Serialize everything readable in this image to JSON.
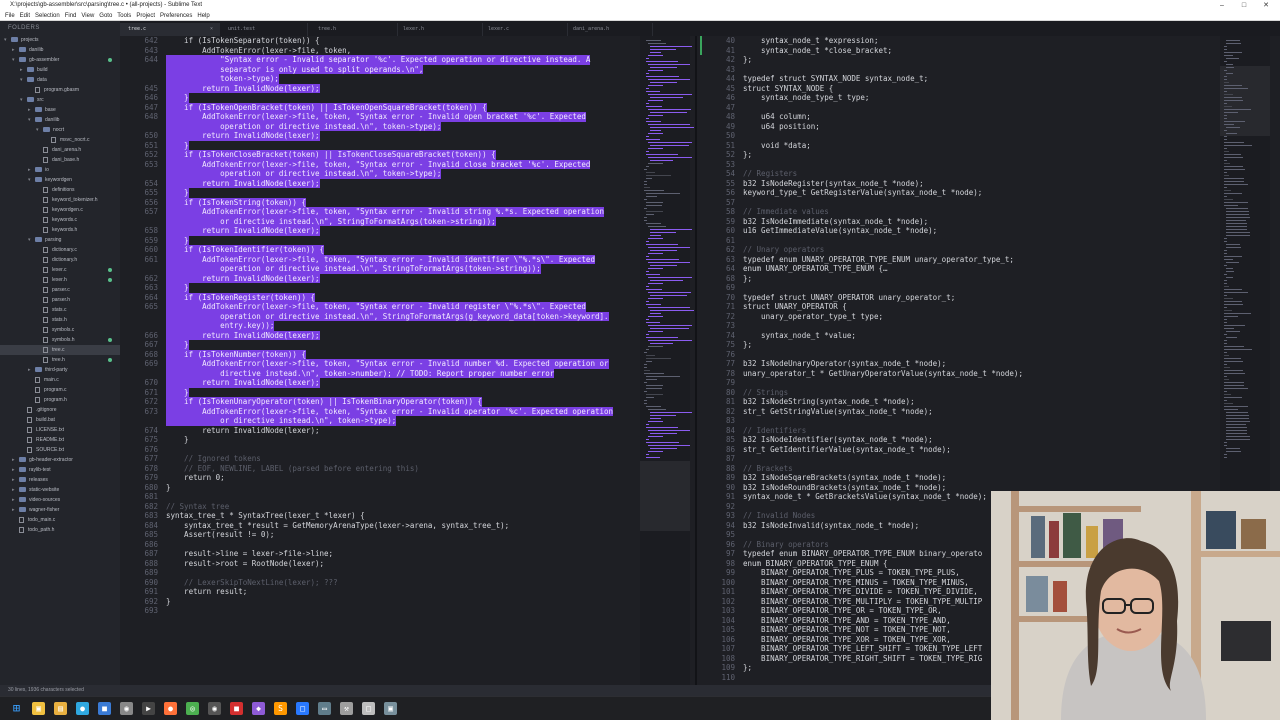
{
  "window": {
    "title": "X:\\projects\\gb-assembler\\src\\parsing\\tree.c • (all-projects) - Sublime Text"
  },
  "menu": [
    "File",
    "Edit",
    "Selection",
    "Find",
    "View",
    "Goto",
    "Tools",
    "Project",
    "Preferences",
    "Help"
  ],
  "sidebar": {
    "header": "FOLDERS",
    "items": [
      {
        "label": "projects",
        "depth": 0,
        "type": "folder",
        "open": true
      },
      {
        "label": "danilib",
        "depth": 1,
        "type": "folder",
        "open": false
      },
      {
        "label": "gb-assembler",
        "depth": 1,
        "type": "folder",
        "open": true,
        "dot": true
      },
      {
        "label": "build",
        "depth": 2,
        "type": "folder",
        "open": false
      },
      {
        "label": "data",
        "depth": 2,
        "type": "folder",
        "open": true
      },
      {
        "label": "program.gbasm",
        "depth": 3,
        "type": "file"
      },
      {
        "label": "src",
        "depth": 2,
        "type": "folder",
        "open": true
      },
      {
        "label": "base",
        "depth": 3,
        "type": "folder",
        "open": false
      },
      {
        "label": "danilib",
        "depth": 3,
        "type": "folder",
        "open": true
      },
      {
        "label": "nocrt",
        "depth": 4,
        "type": "folder",
        "open": true
      },
      {
        "label": "msvc_nocrt.c",
        "depth": 5,
        "type": "file"
      },
      {
        "label": "dani_arena.h",
        "depth": 4,
        "type": "file"
      },
      {
        "label": "dani_base.h",
        "depth": 4,
        "type": "file"
      },
      {
        "label": "io",
        "depth": 3,
        "type": "folder",
        "open": false
      },
      {
        "label": "keywordgen",
        "depth": 3,
        "type": "folder",
        "open": true
      },
      {
        "label": "definitions",
        "depth": 4,
        "type": "file"
      },
      {
        "label": "keyword_tokenizer.h",
        "depth": 4,
        "type": "file"
      },
      {
        "label": "keywordgen.c",
        "depth": 4,
        "type": "file"
      },
      {
        "label": "keywords.c",
        "depth": 4,
        "type": "file"
      },
      {
        "label": "keywords.h",
        "depth": 4,
        "type": "file"
      },
      {
        "label": "parsing",
        "depth": 3,
        "type": "folder",
        "open": true
      },
      {
        "label": "dictionary.c",
        "depth": 4,
        "type": "file"
      },
      {
        "label": "dictionary.h",
        "depth": 4,
        "type": "file"
      },
      {
        "label": "lexer.c",
        "depth": 4,
        "type": "file",
        "dot": true
      },
      {
        "label": "lexer.h",
        "depth": 4,
        "type": "file",
        "dot": true
      },
      {
        "label": "parser.c",
        "depth": 4,
        "type": "file"
      },
      {
        "label": "parser.h",
        "depth": 4,
        "type": "file"
      },
      {
        "label": "stats.c",
        "depth": 4,
        "type": "file"
      },
      {
        "label": "stats.h",
        "depth": 4,
        "type": "file"
      },
      {
        "label": "symbols.c",
        "depth": 4,
        "type": "file"
      },
      {
        "label": "symbols.h",
        "depth": 4,
        "type": "file",
        "dot": true
      },
      {
        "label": "tree.c",
        "depth": 4,
        "type": "file",
        "selected": true
      },
      {
        "label": "tree.h",
        "depth": 4,
        "type": "file",
        "dot": true
      },
      {
        "label": "third-party",
        "depth": 3,
        "type": "folder",
        "open": false
      },
      {
        "label": "main.c",
        "depth": 3,
        "type": "file"
      },
      {
        "label": "program.c",
        "depth": 3,
        "type": "file"
      },
      {
        "label": "program.h",
        "depth": 3,
        "type": "file"
      },
      {
        "label": ".gitignore",
        "depth": 2,
        "type": "file"
      },
      {
        "label": "build.bat",
        "depth": 2,
        "type": "file"
      },
      {
        "label": "LICENSE.txt",
        "depth": 2,
        "type": "file"
      },
      {
        "label": "README.txt",
        "depth": 2,
        "type": "file"
      },
      {
        "label": "SOURCE.txt",
        "depth": 2,
        "type": "file"
      },
      {
        "label": "gb-header-extractor",
        "depth": 1,
        "type": "folder",
        "open": false
      },
      {
        "label": "raylib-test",
        "depth": 1,
        "type": "folder",
        "open": false
      },
      {
        "label": "releases",
        "depth": 1,
        "type": "folder",
        "open": false
      },
      {
        "label": "static-website",
        "depth": 1,
        "type": "folder",
        "open": false
      },
      {
        "label": "video-sources",
        "depth": 1,
        "type": "folder",
        "open": false
      },
      {
        "label": "wagner-fisher",
        "depth": 1,
        "type": "folder",
        "open": false
      },
      {
        "label": "todo_main.c",
        "depth": 1,
        "type": "file"
      },
      {
        "label": "todo_path.h",
        "depth": 1,
        "type": "file"
      }
    ]
  },
  "tabs": [
    {
      "label": "tree.c",
      "active": true
    },
    {
      "label": "unit.test",
      "active": false
    },
    {
      "label": "tree.h",
      "active": false
    },
    {
      "label": "lexer.h",
      "active": false
    },
    {
      "label": "lexer.c",
      "active": false
    },
    {
      "label": "dani_arena.h",
      "active": false
    }
  ],
  "left_code": [
    {
      "n": "642",
      "t": "    if (IsTokenSeparator(token)) {"
    },
    {
      "n": "643",
      "t": "        AddTokenError(lexer->file, token,"
    },
    {
      "n": "644",
      "t": "            \"Syntax error - Invalid separator '%c'. Expected operation or directive instead. A",
      "hl": true
    },
    {
      "n": "",
      "t": "            separator is only used to split operands.\\n\",",
      "hl": true
    },
    {
      "n": "",
      "t": "            token->type);",
      "hl": true
    },
    {
      "n": "645",
      "t": "        return InvalidNode(lexer);",
      "hl": true
    },
    {
      "n": "646",
      "t": "    }",
      "hl": true
    },
    {
      "n": "647",
      "t": "    if (IsTokenOpenBracket(token) || IsTokenOpenSquareBracket(token)) {",
      "hl": true
    },
    {
      "n": "648",
      "t": "        AddTokenError(lexer->file, token, \"Syntax error - Invalid open bracket '%c'. Expected",
      "hl": true
    },
    {
      "n": "",
      "t": "            operation or directive instead.\\n\", token->type);",
      "hl": true
    },
    {
      "n": "650",
      "t": "        return InvalidNode(lexer);",
      "hl": true
    },
    {
      "n": "651",
      "t": "    }",
      "hl": true
    },
    {
      "n": "652",
      "t": "    if (IsTokenCloseBracket(token) || IsTokenCloseSquareBracket(token)) {",
      "hl": true
    },
    {
      "n": "653",
      "t": "        AddTokenError(lexer->file, token, \"Syntax error - Invalid close bracket '%c'. Expected",
      "hl": true
    },
    {
      "n": "",
      "t": "            operation or directive instead.\\n\", token->type);",
      "hl": true
    },
    {
      "n": "654",
      "t": "        return InvalidNode(lexer);",
      "hl": true
    },
    {
      "n": "655",
      "t": "    }",
      "hl": true
    },
    {
      "n": "656",
      "t": "    if (IsTokenString(token)) {",
      "hl": true
    },
    {
      "n": "657",
      "t": "        AddTokenError(lexer->file, token, \"Syntax error - Invalid string %.*s. Expected operation",
      "hl": true
    },
    {
      "n": "",
      "t": "            or directive instead.\\n\", StringToFormatArgs(token->string));",
      "hl": true
    },
    {
      "n": "658",
      "t": "        return InvalidNode(lexer);",
      "hl": true
    },
    {
      "n": "659",
      "t": "    }",
      "hl": true
    },
    {
      "n": "660",
      "t": "    if (IsTokenIdentifier(token)) {",
      "hl": true
    },
    {
      "n": "661",
      "t": "        AddTokenError(lexer->file, token, \"Syntax error - Invalid identifier \\\"%.*s\\\". Expected",
      "hl": true
    },
    {
      "n": "",
      "t": "            operation or directive instead.\\n\", StringToFormatArgs(token->string));",
      "hl": true
    },
    {
      "n": "662",
      "t": "        return InvalidNode(lexer);",
      "hl": true
    },
    {
      "n": "663",
      "t": "    }",
      "hl": true
    },
    {
      "n": "664",
      "t": "    if (IsTokenRegister(token)) {",
      "hl": true
    },
    {
      "n": "665",
      "t": "        AddTokenError(lexer->file, token, \"Syntax error - Invalid register \\\"%.*s\\\". Expected",
      "hl": true
    },
    {
      "n": "",
      "t": "            operation or directive instead.\\n\", StringToFormatArgs(g_keyword_data[token->keyword].",
      "hl": true
    },
    {
      "n": "",
      "t": "            entry.key));",
      "hl": true
    },
    {
      "n": "666",
      "t": "        return InvalidNode(lexer);",
      "hl": true
    },
    {
      "n": "667",
      "t": "    }",
      "hl": true
    },
    {
      "n": "668",
      "t": "    if (IsTokenNumber(token)) {",
      "hl": true
    },
    {
      "n": "669",
      "t": "        AddTokenError(lexer->file, token, \"Syntax error - Invalid number %d. Expected operation or",
      "hl": true
    },
    {
      "n": "",
      "t": "            directive instead.\\n\", token->number); // TODO: Report proper number error",
      "hl": true
    },
    {
      "n": "670",
      "t": "        return InvalidNode(lexer);",
      "hl": true
    },
    {
      "n": "671",
      "t": "    }",
      "hl": true
    },
    {
      "n": "672",
      "t": "    if (IsTokenUnaryOperator(token) || IsTokenBinaryOperator(token)) {",
      "hl": true
    },
    {
      "n": "673",
      "t": "        AddTokenError(lexer->file, token, \"Syntax error - Invalid operator '%c'. Expected operation",
      "hl": true
    },
    {
      "n": "",
      "t": "            or directive instead.\\n\", token->type);",
      "hl": true
    },
    {
      "n": "674",
      "t": "        return InvalidNode(lexer);"
    },
    {
      "n": "675",
      "t": "    }"
    },
    {
      "n": "676",
      "t": ""
    },
    {
      "n": "677",
      "t": "    // Ignored tokens",
      "c": true
    },
    {
      "n": "678",
      "t": "    // EOF, NEWLINE, LABEL (parsed before entering this)",
      "c": true
    },
    {
      "n": "679",
      "t": "    return 0;"
    },
    {
      "n": "680",
      "t": "}"
    },
    {
      "n": "681",
      "t": ""
    },
    {
      "n": "682",
      "t": "// Syntax tree",
      "c": true
    },
    {
      "n": "683",
      "t": "syntax_tree_t * SyntaxTree(lexer_t *lexer) {"
    },
    {
      "n": "684",
      "t": "    syntax_tree_t *result = GetMemoryArenaType(lexer->arena, syntax_tree_t);"
    },
    {
      "n": "685",
      "t": "    Assert(result != 0);"
    },
    {
      "n": "686",
      "t": ""
    },
    {
      "n": "687",
      "t": "    result->line = lexer->file->line;"
    },
    {
      "n": "688",
      "t": "    result->root = RootNode(lexer);"
    },
    {
      "n": "689",
      "t": ""
    },
    {
      "n": "690",
      "t": "    // LexerSkipToNextLine(lexer); ???",
      "c": true
    },
    {
      "n": "691",
      "t": "    return result;"
    },
    {
      "n": "692",
      "t": "}"
    },
    {
      "n": "693",
      "t": ""
    }
  ],
  "right_code": [
    {
      "n": "40",
      "t": "    syntax_node_t *expression;",
      "g": true
    },
    {
      "n": "41",
      "t": "    syntax_node_t *close_bracket;",
      "g": true
    },
    {
      "n": "42",
      "t": "};"
    },
    {
      "n": "43",
      "t": ""
    },
    {
      "n": "44",
      "t": "typedef struct SYNTAX_NODE syntax_node_t;"
    },
    {
      "n": "45",
      "t": "struct SYNTAX_NODE {"
    },
    {
      "n": "46",
      "t": "    syntax_node_type_t type;"
    },
    {
      "n": "47",
      "t": ""
    },
    {
      "n": "48",
      "t": "    u64 column;"
    },
    {
      "n": "49",
      "t": "    u64 position;"
    },
    {
      "n": "50",
      "t": ""
    },
    {
      "n": "51",
      "t": "    void *data;"
    },
    {
      "n": "52",
      "t": "};"
    },
    {
      "n": "53",
      "t": ""
    },
    {
      "n": "54",
      "t": "// Registers",
      "c": true
    },
    {
      "n": "55",
      "t": "b32 IsNodeRegister(syntax_node_t *node);"
    },
    {
      "n": "56",
      "t": "keyword_type_t GetRegisterValue(syntax_node_t *node);"
    },
    {
      "n": "57",
      "t": ""
    },
    {
      "n": "58",
      "t": "// Immediate values",
      "c": true
    },
    {
      "n": "59",
      "t": "b32 IsNodeImmediate(syntax_node_t *node);"
    },
    {
      "n": "60",
      "t": "u16 GetImmediateValue(syntax_node_t *node);"
    },
    {
      "n": "61",
      "t": ""
    },
    {
      "n": "62",
      "t": "// Unary operators",
      "c": true
    },
    {
      "n": "63",
      "t": "typedef enum UNARY_OPERATOR_TYPE_ENUM unary_operator_type_t;"
    },
    {
      "n": "64",
      "t": "enum UNARY_OPERATOR_TYPE_ENUM {…"
    },
    {
      "n": "68",
      "t": "};"
    },
    {
      "n": "69",
      "t": ""
    },
    {
      "n": "70",
      "t": "typedef struct UNARY_OPERATOR unary_operator_t;"
    },
    {
      "n": "71",
      "t": "struct UNARY_OPERATOR {"
    },
    {
      "n": "72",
      "t": "    unary_operator_type_t type;"
    },
    {
      "n": "73",
      "t": ""
    },
    {
      "n": "74",
      "t": "    syntax_node_t *value;"
    },
    {
      "n": "75",
      "t": "};"
    },
    {
      "n": "76",
      "t": ""
    },
    {
      "n": "77",
      "t": "b32 IsNodeUnaryOperator(syntax_node_t *node);"
    },
    {
      "n": "78",
      "t": "unary_operator_t * GetUnaryOperatorValue(syntax_node_t *node);"
    },
    {
      "n": "79",
      "t": ""
    },
    {
      "n": "80",
      "t": "// Strings",
      "c": true
    },
    {
      "n": "81",
      "t": "b32 IsNodeString(syntax_node_t *node);"
    },
    {
      "n": "82",
      "t": "str_t GetStringValue(syntax_node_t *node);"
    },
    {
      "n": "83",
      "t": ""
    },
    {
      "n": "84",
      "t": "// Identifiers",
      "c": true
    },
    {
      "n": "85",
      "t": "b32 IsNodeIdentifier(syntax_node_t *node);"
    },
    {
      "n": "86",
      "t": "str_t GetIdentifierValue(syntax_node_t *node);"
    },
    {
      "n": "87",
      "t": ""
    },
    {
      "n": "88",
      "t": "// Brackets",
      "c": true
    },
    {
      "n": "89",
      "t": "b32 IsNodeSqareBrackets(syntax_node_t *node);"
    },
    {
      "n": "90",
      "t": "b32 IsNodeRoundBrackets(syntax_node_t *node);"
    },
    {
      "n": "91",
      "t": "syntax_node_t * GetBracketsValue(syntax_node_t *node);"
    },
    {
      "n": "92",
      "t": ""
    },
    {
      "n": "93",
      "t": "// Invalid Nodes",
      "c": true
    },
    {
      "n": "94",
      "t": "b32 IsNodeInvalid(syntax_node_t *node);"
    },
    {
      "n": "95",
      "t": ""
    },
    {
      "n": "96",
      "t": "// Binary operators",
      "c": true
    },
    {
      "n": "97",
      "t": "typedef enum BINARY_OPERATOR_TYPE_ENUM binary_operato"
    },
    {
      "n": "98",
      "t": "enum BINARY_OPERATOR_TYPE_ENUM {"
    },
    {
      "n": "99",
      "t": "    BINARY_OPERATOR_TYPE_PLUS = TOKEN_TYPE_PLUS,"
    },
    {
      "n": "100",
      "t": "    BINARY_OPERATOR_TYPE_MINUS = TOKEN_TYPE_MINUS,"
    },
    {
      "n": "101",
      "t": "    BINARY_OPERATOR_TYPE_DIVIDE = TOKEN_TYPE_DIVIDE,"
    },
    {
      "n": "102",
      "t": "    BINARY_OPERATOR_TYPE_MULTIPLY = TOKEN_TYPE_MULTIP"
    },
    {
      "n": "103",
      "t": "    BINARY_OPERATOR_TYPE_OR = TOKEN_TYPE_OR,"
    },
    {
      "n": "104",
      "t": "    BINARY_OPERATOR_TYPE_AND = TOKEN_TYPE_AND,"
    },
    {
      "n": "105",
      "t": "    BINARY_OPERATOR_TYPE_NOT = TOKEN_TYPE_NOT,"
    },
    {
      "n": "106",
      "t": "    BINARY_OPERATOR_TYPE_XOR = TOKEN_TYPE_XOR,"
    },
    {
      "n": "107",
      "t": "    BINARY_OPERATOR_TYPE_LEFT_SHIFT = TOKEN_TYPE_LEFT"
    },
    {
      "n": "108",
      "t": "    BINARY_OPERATOR_TYPE_RIGHT_SHIFT = TOKEN_TYPE_RIG"
    },
    {
      "n": "109",
      "t": "};"
    },
    {
      "n": "110",
      "t": ""
    }
  ],
  "statusbar": {
    "text": "30 lines, 1936 characters selected"
  },
  "taskbar": {
    "icons": [
      "windows-start-icon",
      "file-explorer-icon",
      "folder-icon",
      "browser-icon",
      "store-icon",
      "github-icon",
      "terminal-icon",
      "firefox-icon",
      "chrome-icon",
      "obs-icon",
      "pdf-icon",
      "visual-studio-icon",
      "sublime-icon",
      "editor-icon",
      "screen-icon",
      "tool-icon",
      "notes-icon",
      "app-icon"
    ]
  },
  "colors": {
    "selection": "#7b3fe4",
    "background": "#1e1f24",
    "sidebar": "#23252b",
    "modified_dot": "#58c08a"
  }
}
